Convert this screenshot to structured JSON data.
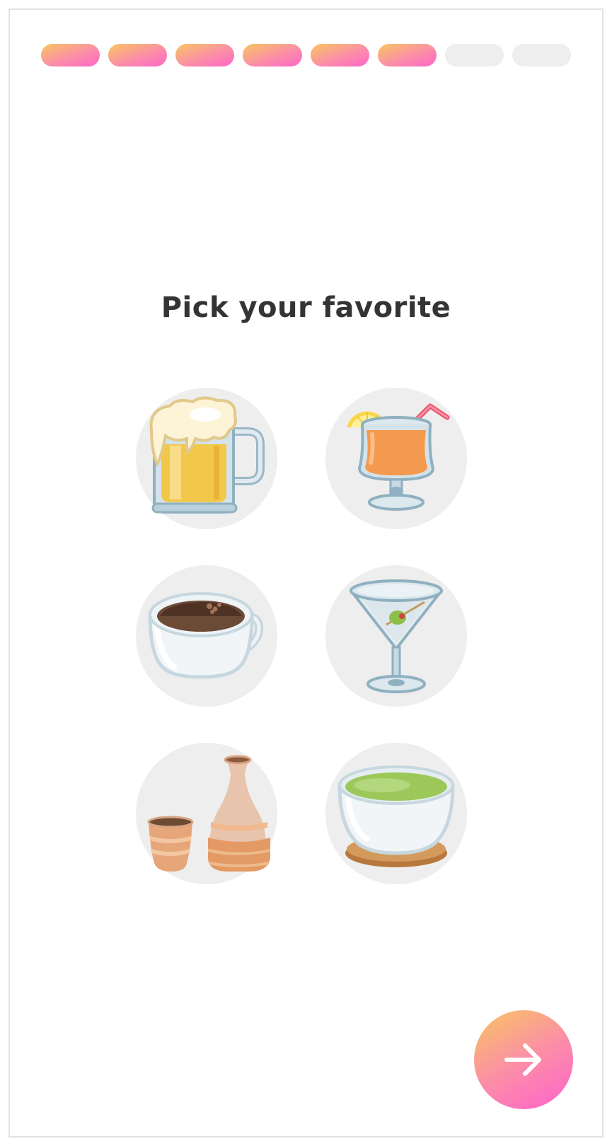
{
  "onboarding": {
    "progress": {
      "total_steps": 8,
      "completed_steps": 6
    },
    "title": "Pick your favorite",
    "options": [
      {
        "icon": "beer-mug-icon"
      },
      {
        "icon": "tropical-cocktail-icon"
      },
      {
        "icon": "coffee-cup-icon"
      },
      {
        "icon": "martini-glass-icon"
      },
      {
        "icon": "sake-bottle-and-cup-icon"
      },
      {
        "icon": "matcha-tea-bowl-icon"
      }
    ],
    "next_button": {
      "icon": "arrow-right-icon"
    }
  },
  "colors": {
    "gradient_start": "#f8c65f",
    "gradient_end": "#ff66c9",
    "inactive_segment": "#eeeeee",
    "option_background": "#eeeeee",
    "title_text": "#343434"
  }
}
